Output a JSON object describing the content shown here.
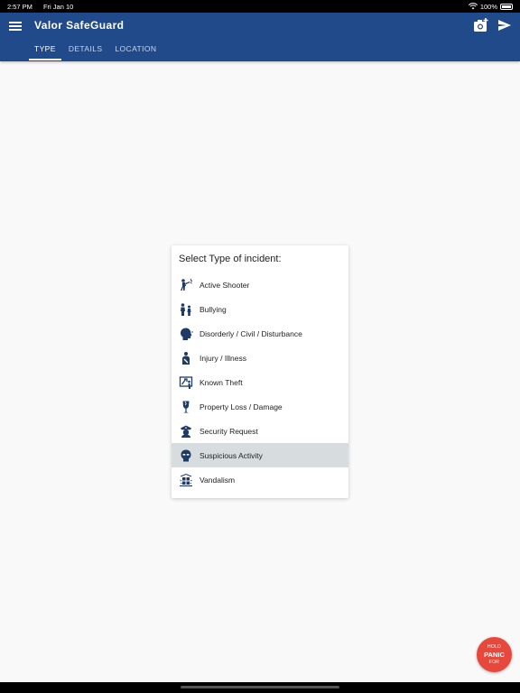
{
  "status_bar": {
    "time": "2:57 PM",
    "date": "Fri Jan 10",
    "battery": "100%"
  },
  "app_bar": {
    "title": "Valor SafeGuard",
    "tabs": [
      {
        "label": "TYPE",
        "active": true
      },
      {
        "label": "DETAILS",
        "active": false
      },
      {
        "label": "LOCATION",
        "active": false
      }
    ]
  },
  "incident_dialog": {
    "title": "Select Type of incident:",
    "options": [
      {
        "label": "Active Shooter",
        "icon": "active-shooter-icon",
        "selected": false
      },
      {
        "label": "Bullying",
        "icon": "bullying-icon",
        "selected": false
      },
      {
        "label": "Disorderly / Civil / Disturbance",
        "icon": "disorderly-icon",
        "selected": false
      },
      {
        "label": "Injury / Illness",
        "icon": "injury-icon",
        "selected": false
      },
      {
        "label": "Known Theft",
        "icon": "theft-icon",
        "selected": false
      },
      {
        "label": "Property Loss / Damage",
        "icon": "property-icon",
        "selected": false
      },
      {
        "label": "Security Request",
        "icon": "security-icon",
        "selected": false
      },
      {
        "label": "Suspicious Activity",
        "icon": "suspicious-icon",
        "selected": true
      },
      {
        "label": "Vandalism",
        "icon": "vandalism-icon",
        "selected": false
      }
    ]
  },
  "panic_button": {
    "line1": "HOLD",
    "line2": "PANIC",
    "line3": "FOR"
  },
  "colors": {
    "brand_blue": "#214a8a",
    "panic_red": "#e8473c",
    "selected_row": "#d7dcdf",
    "icon_navy": "#1f3a66"
  }
}
